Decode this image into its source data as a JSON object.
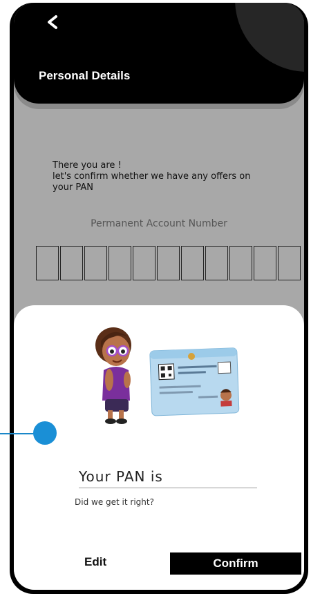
{
  "header": {
    "title": "Personal Details",
    "back_icon": "chevron-left-icon"
  },
  "intro": {
    "line1": "There you are !",
    "line2": "let's confirm whether we have any offers on",
    "line3": "your PAN"
  },
  "pan": {
    "label": "Permanent Account Number",
    "box_count": 11
  },
  "sheet": {
    "title": "Your PAN is",
    "question": "Did we get it right?",
    "edit_label": "Edit",
    "confirm_label": "Confirm"
  },
  "colors": {
    "header_bg": "#000000",
    "screen_bg": "#a8a8a8",
    "sheet_bg": "#ffffff",
    "confirm_bg": "#000000",
    "pointer": "#1a8fd6"
  }
}
